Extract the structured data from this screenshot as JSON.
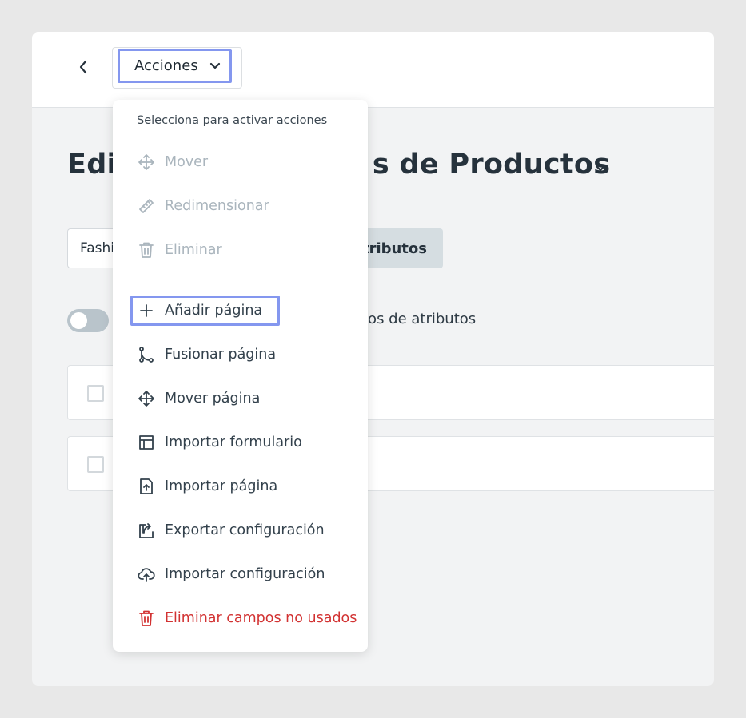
{
  "toolbar": {
    "actions_label": "Acciones"
  },
  "page": {
    "title": "Editar Atributos de Productos",
    "title_visible": "Edi",
    "title_visible_end": "s de Productos"
  },
  "filters": {
    "select_value": "Fashi",
    "attributes_button": "atributos"
  },
  "toggle": {
    "label": "tos de atributos",
    "on": false
  },
  "menu": {
    "header": "Selecciona para activar acciones",
    "items": [
      {
        "label": "Mover",
        "icon": "move-icon",
        "state": "disabled"
      },
      {
        "label": "Redimensionar",
        "icon": "ruler-icon",
        "state": "disabled"
      },
      {
        "label": "Eliminar",
        "icon": "trash-icon",
        "state": "disabled"
      },
      {
        "label": "Añadir página",
        "icon": "plus-icon",
        "state": "focused"
      },
      {
        "label": "Fusionar página",
        "icon": "merge-icon",
        "state": "normal"
      },
      {
        "label": "Mover página",
        "icon": "move-icon",
        "state": "normal"
      },
      {
        "label": "Importar formulario",
        "icon": "layout-icon",
        "state": "normal"
      },
      {
        "label": "Importar página",
        "icon": "file-upload-icon",
        "state": "normal"
      },
      {
        "label": "Exportar configuración",
        "icon": "export-icon",
        "state": "normal"
      },
      {
        "label": "Importar configuración",
        "icon": "cloud-upload-icon",
        "state": "normal"
      },
      {
        "label": "Eliminar campos no usados",
        "icon": "trash-icon",
        "state": "danger"
      }
    ]
  },
  "colors": {
    "focus": "#8497ef",
    "danger": "#d23232",
    "disabled": "#aab5bd",
    "text": "#33414c",
    "background": "#e8e8e8"
  }
}
